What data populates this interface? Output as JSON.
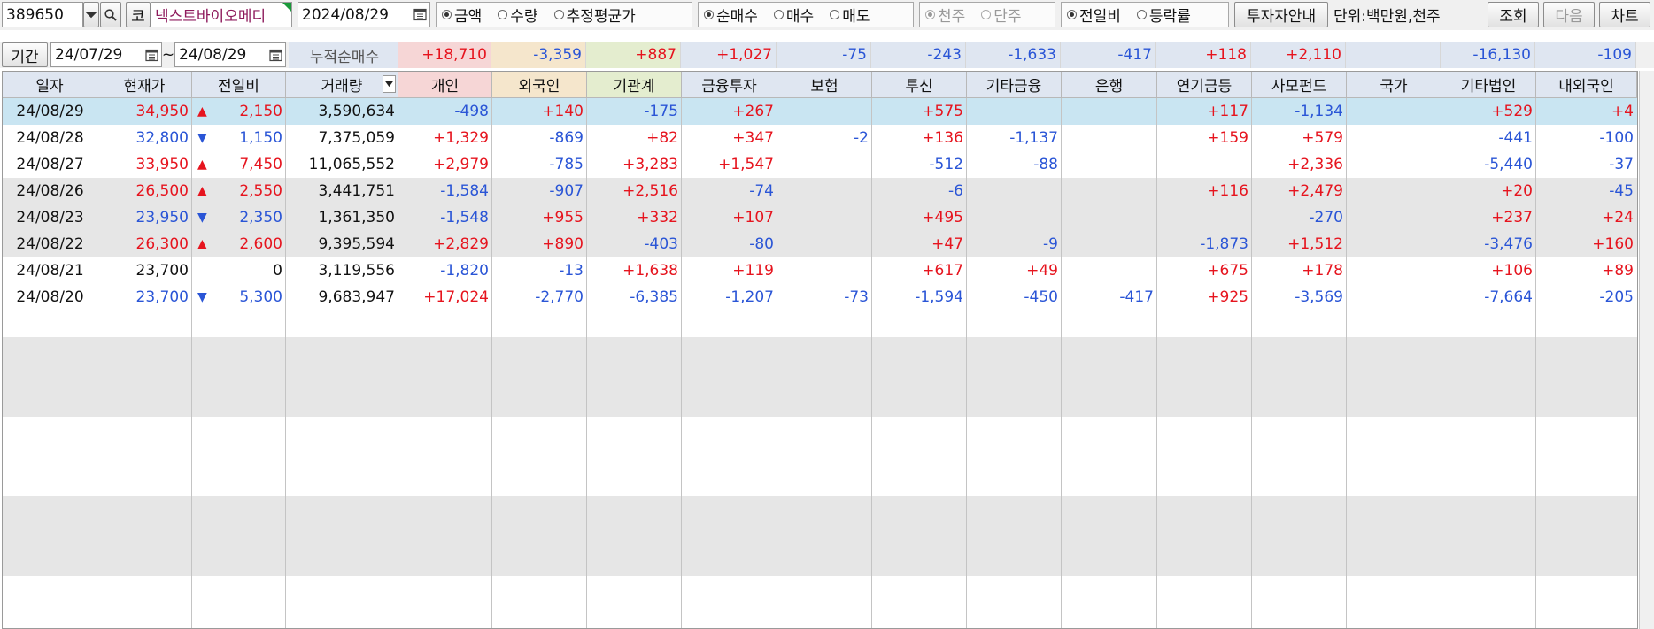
{
  "toolbar": {
    "code": "389650",
    "code_type_button": "코",
    "stock_name": "넥스트바이오메디",
    "date": "2024/08/29",
    "value_type": [
      "금액",
      "수량",
      "추정평균가"
    ],
    "trade_type": [
      "순매수",
      "매수",
      "매도"
    ],
    "share_unit": [
      "천주",
      "단주"
    ],
    "compare_type": [
      "전일비",
      "등락률"
    ],
    "investor_guide_button": "투자자안내",
    "unit_label": "단위:백만원,천주",
    "search_button": "조회",
    "next_button": "다음",
    "chart_button": "차트"
  },
  "period": {
    "label": "기간",
    "from": "24/07/29",
    "separator": "~",
    "to": "24/08/29",
    "sum_label": "누적순매수"
  },
  "summary": [
    "+18,710",
    "-3,359",
    "+887",
    "+1,027",
    "-75",
    "-243",
    "-1,633",
    "-417",
    "+118",
    "+2,110",
    "",
    "-16,130",
    "-109"
  ],
  "columns": [
    "일자",
    "현재가",
    "전일비",
    "거래량",
    "개인",
    "외국인",
    "기관계",
    "금융투자",
    "보험",
    "투신",
    "기타금융",
    "은행",
    "연기금등",
    "사모펀드",
    "국가",
    "기타법인",
    "내외국인"
  ],
  "rows": [
    {
      "date": "24/08/29",
      "price": "34,950",
      "arrow": "▲",
      "change": "2,150",
      "volume": "3,590,634",
      "v": [
        "-498",
        "+140",
        "-175",
        "+267",
        "",
        "+575",
        "",
        "",
        "+117",
        "-1,134",
        "",
        "+529",
        "+4"
      ]
    },
    {
      "date": "24/08/28",
      "price": "32,800",
      "arrow": "▼",
      "change": "1,150",
      "volume": "7,375,059",
      "v": [
        "+1,329",
        "-869",
        "+82",
        "+347",
        "-2",
        "+136",
        "-1,137",
        "",
        "+159",
        "+579",
        "",
        "-441",
        "-100"
      ]
    },
    {
      "date": "24/08/27",
      "price": "33,950",
      "arrow": "▲",
      "change": "7,450",
      "volume": "11,065,552",
      "v": [
        "+2,979",
        "-785",
        "+3,283",
        "+1,547",
        "",
        "-512",
        "-88",
        "",
        "",
        "+2,336",
        "",
        "-5,440",
        "-37"
      ]
    },
    {
      "date": "24/08/26",
      "price": "26,500",
      "arrow": "▲",
      "change": "2,550",
      "volume": "3,441,751",
      "v": [
        "-1,584",
        "-907",
        "+2,516",
        "-74",
        "",
        "-6",
        "",
        "",
        "+116",
        "+2,479",
        "",
        "+20",
        "-45"
      ]
    },
    {
      "date": "24/08/23",
      "price": "23,950",
      "arrow": "▼",
      "change": "2,350",
      "volume": "1,361,350",
      "v": [
        "-1,548",
        "+955",
        "+332",
        "+107",
        "",
        "+495",
        "",
        "",
        "",
        "-270",
        "",
        "+237",
        "+24"
      ]
    },
    {
      "date": "24/08/22",
      "price": "26,300",
      "arrow": "▲",
      "change": "2,600",
      "volume": "9,395,594",
      "v": [
        "+2,829",
        "+890",
        "-403",
        "-80",
        "",
        "+47",
        "-9",
        "",
        "-1,873",
        "+1,512",
        "",
        "-3,476",
        "+160"
      ]
    },
    {
      "date": "24/08/21",
      "price": "23,700",
      "arrow": "",
      "change": "0",
      "volume": "3,119,556",
      "v": [
        "-1,820",
        "-13",
        "+1,638",
        "+119",
        "",
        "+617",
        "+49",
        "",
        "+675",
        "+178",
        "",
        "+106",
        "+89"
      ]
    },
    {
      "date": "24/08/20",
      "price": "23,700",
      "arrow": "▼",
      "change": "5,300",
      "volume": "9,683,947",
      "v": [
        "+17,024",
        "-2,770",
        "-6,385",
        "-1,207",
        "-73",
        "-1,594",
        "-450",
        "-417",
        "+925",
        "-3,569",
        "",
        "-7,664",
        "-205"
      ]
    }
  ],
  "colors": {
    "header_bg": "#dfe6f1",
    "individual_bg": "#f6d6d6",
    "foreign_bg": "#f5e6cc",
    "institution_bg": "#e4edcf",
    "selected_row_bg": "#c9e5f2",
    "band_bg": "#e6e6e6",
    "positive": "#e6141e",
    "negative": "#2a55d6"
  }
}
